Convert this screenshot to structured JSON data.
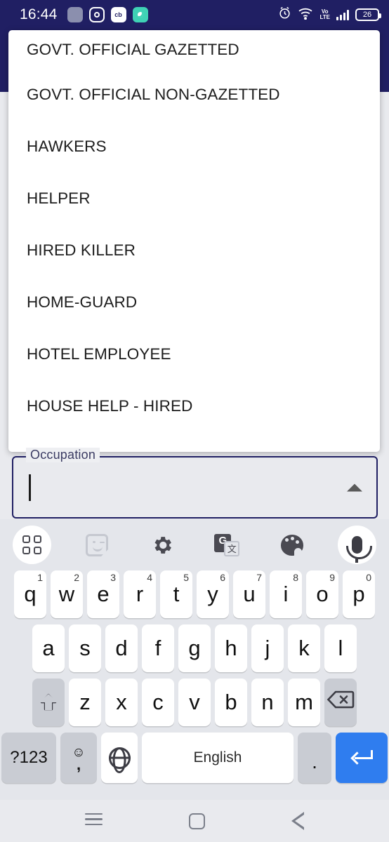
{
  "status_bar": {
    "time": "16:44",
    "notification_icons": [
      "app-icon",
      "instagram-icon",
      "cb-app-icon",
      "chat-app-icon"
    ],
    "cb_label": "cb",
    "volte_top": "Vo",
    "volte_bottom": "LTE",
    "battery_percent": "26",
    "icons": [
      "alarm-icon",
      "wifi-icon",
      "volte-icon",
      "signal-icon",
      "battery-icon"
    ]
  },
  "colors": {
    "app_bar": "#201f63",
    "field_border": "#201f63",
    "keyboard_bg": "#e4e6eb",
    "key_white": "#ffffff",
    "key_grey": "#c9ccd3",
    "enter_blue": "#2f7def",
    "page_bg": "#e9eaee"
  },
  "dropdown": {
    "items": [
      {
        "label": "GOVT. OFFICIAL GAZETTED"
      },
      {
        "label": "GOVT. OFFICIAL NON-GAZETTED"
      },
      {
        "label": "HAWKERS"
      },
      {
        "label": "HELPER"
      },
      {
        "label": "HIRED KILLER"
      },
      {
        "label": "HOME-GUARD"
      },
      {
        "label": "HOTEL EMPLOYEE"
      },
      {
        "label": "HOUSE HELP - HIRED"
      }
    ]
  },
  "form": {
    "occupation": {
      "label": "Occupation",
      "value": "",
      "state": "expanded",
      "arrow": "caret-up-icon"
    }
  },
  "keyboard": {
    "toolbar": [
      {
        "name": "grid-icon"
      },
      {
        "name": "sticker-icon"
      },
      {
        "name": "gear-icon"
      },
      {
        "name": "translate-icon",
        "g": "G",
        "t": "文"
      },
      {
        "name": "palette-icon"
      },
      {
        "name": "microphone-icon"
      }
    ],
    "row1": [
      {
        "key": "q",
        "num": "1"
      },
      {
        "key": "w",
        "num": "2"
      },
      {
        "key": "e",
        "num": "3"
      },
      {
        "key": "r",
        "num": "4"
      },
      {
        "key": "t",
        "num": "5"
      },
      {
        "key": "y",
        "num": "6"
      },
      {
        "key": "u",
        "num": "7"
      },
      {
        "key": "i",
        "num": "8"
      },
      {
        "key": "o",
        "num": "9"
      },
      {
        "key": "p",
        "num": "0"
      }
    ],
    "row2": [
      {
        "key": "a"
      },
      {
        "key": "s"
      },
      {
        "key": "d"
      },
      {
        "key": "f"
      },
      {
        "key": "g"
      },
      {
        "key": "h"
      },
      {
        "key": "j"
      },
      {
        "key": "k"
      },
      {
        "key": "l"
      }
    ],
    "row3": [
      {
        "key": "z"
      },
      {
        "key": "x"
      },
      {
        "key": "c"
      },
      {
        "key": "v"
      },
      {
        "key": "b"
      },
      {
        "key": "n"
      },
      {
        "key": "m"
      }
    ],
    "shift_label": "shift-icon",
    "backspace_label": "backspace-icon",
    "row4": {
      "symbols": "?123",
      "emoji": "☺",
      "comma": ",",
      "globe": "globe-icon",
      "space": "English",
      "period": ".",
      "enter": "enter-icon"
    }
  },
  "system_nav": {
    "recents": "recents-icon",
    "home": "home-icon",
    "back": "back-icon"
  }
}
